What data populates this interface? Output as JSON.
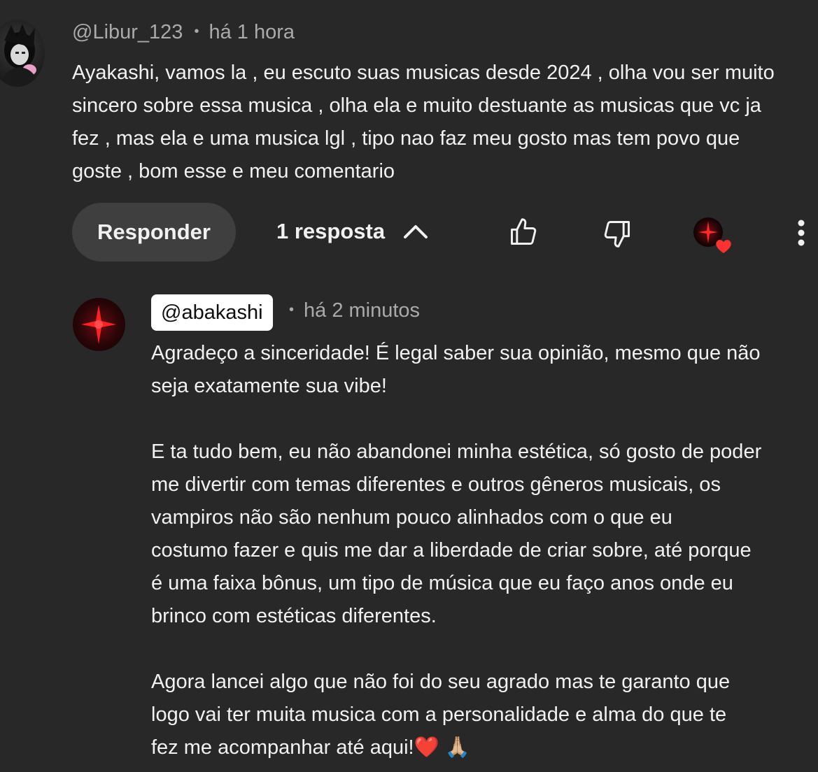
{
  "comment": {
    "author": "@Libur_123",
    "separator": "•",
    "time": "há 1 hora",
    "lines": [
      "Ayakashi, vamos la , eu escuto suas musicas desde 2024 , olha vou ser muito",
      "sincero sobre essa musica , olha ela e muito destuante as musicas que vc ja",
      "fez , mas ela e uma musica lgl , tipo nao faz meu gosto mas tem povo que",
      "goste , bom esse e meu comentario"
    ]
  },
  "actions": {
    "reply_label": "Responder",
    "replies_label": "1 resposta",
    "like_icon": "thumbs-up-icon",
    "dislike_icon": "thumbs-down-icon",
    "hearted_icon": "creator-heart-icon",
    "more_icon": "more-vert-icon"
  },
  "reply": {
    "author": "@abakashi",
    "separator": "•",
    "time": "há 2 minutos",
    "lines": [
      "Agradeço a sinceridade! É legal saber sua opinião, mesmo que não",
      "seja exatamente sua vibe!",
      "",
      "E ta tudo bem, eu não abandonei minha estética, só gosto de poder",
      "me divertir com temas diferentes e outros gêneros musicais, os",
      "vampiros não são nenhum pouco alinhados com o que eu",
      "costumo fazer e quis me dar a liberdade de criar sobre, até porque",
      "é uma faixa bônus, um tipo de música que eu faço anos onde eu",
      "brinco com estéticas diferentes.",
      "",
      "Agora lancei algo que não foi do seu agrado mas te garanto que",
      "logo vai ter muita musica com a personalidade e alma do que te",
      "fez me acompanhar até aqui!❤️ 🙏🏼"
    ]
  },
  "colors": {
    "background": "#282828",
    "text": "#f1f1f1",
    "muted": "#aaaaaa",
    "button": "#3f3f3f",
    "heart": "#ff3030"
  }
}
